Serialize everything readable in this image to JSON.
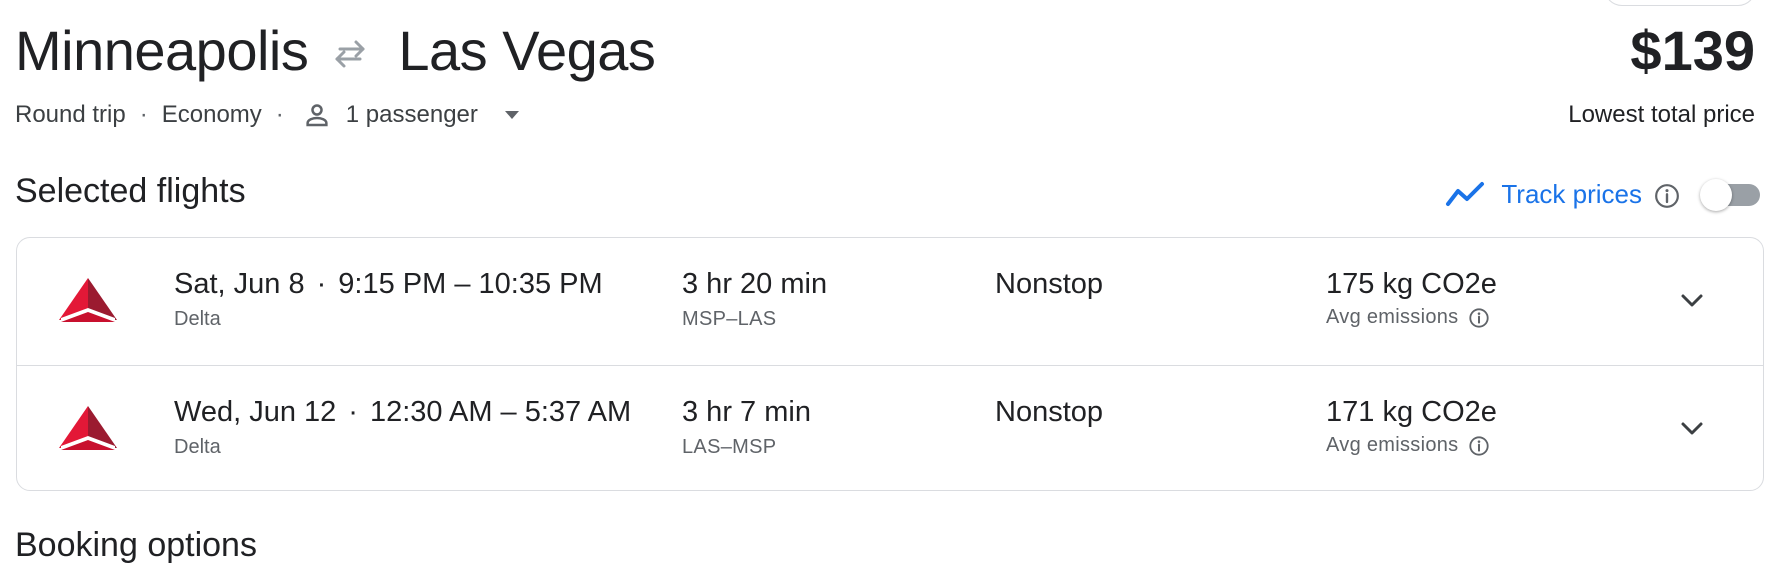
{
  "trip": {
    "origin": "Minneapolis",
    "destination": "Las Vegas",
    "trip_type": "Round trip",
    "cabin_class": "Economy",
    "passengers": "1 passenger",
    "separator": "·"
  },
  "price": {
    "amount": "$139",
    "caption": "Lowest total price"
  },
  "section": {
    "title": "Selected flights",
    "next_title": "Booking options"
  },
  "track_prices": {
    "label": "Track prices",
    "enabled": false
  },
  "flights": [
    {
      "date": "Sat, Jun 8",
      "times": "9:15 PM – 10:35 PM",
      "airline": "Delta",
      "duration": "3 hr 20 min",
      "airports": "MSP–LAS",
      "stops": "Nonstop",
      "emissions": "175 kg CO2e",
      "emissions_label": "Avg emissions"
    },
    {
      "date": "Wed, Jun 12",
      "times": "12:30 AM – 5:37 AM",
      "airline": "Delta",
      "duration": "3 hr 7 min",
      "airports": "LAS–MSP",
      "stops": "Nonstop",
      "emissions": "171 kg CO2e",
      "emissions_label": "Avg emissions"
    }
  ],
  "colors": {
    "accent_blue": "#1a73e8",
    "delta_red": "#c8102e",
    "text_primary": "#202124",
    "text_secondary": "#5f6368",
    "border": "#dadce0"
  },
  "icons": {
    "swap": "swap-arrows-icon",
    "passenger": "person-icon",
    "dropdown": "caret-down-icon",
    "trend": "trending-line-icon",
    "info": "info-icon",
    "expand": "chevron-down-icon",
    "airline": "delta-logo-icon"
  }
}
